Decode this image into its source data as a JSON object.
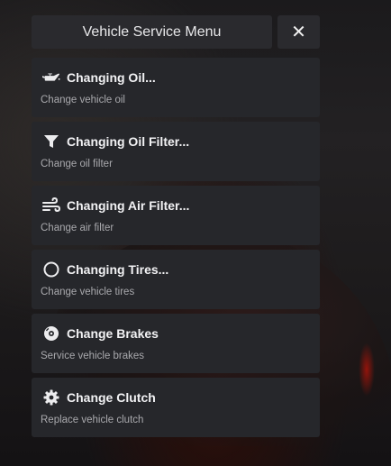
{
  "header": {
    "title": "Vehicle Service Menu",
    "close_label": "✕"
  },
  "menu": {
    "items": [
      {
        "icon": "oil-can-icon",
        "label": "Changing Oil...",
        "description": "Change vehicle oil"
      },
      {
        "icon": "filter-icon",
        "label": "Changing Oil Filter...",
        "description": "Change oil filter"
      },
      {
        "icon": "wind-icon",
        "label": "Changing Air Filter...",
        "description": "Change air filter"
      },
      {
        "icon": "circle-icon",
        "label": "Changing Tires...",
        "description": "Change vehicle tires"
      },
      {
        "icon": "brake-disc-icon",
        "label": "Change Brakes",
        "description": "Service vehicle brakes"
      },
      {
        "icon": "gear-icon",
        "label": "Change Clutch",
        "description": "Replace vehicle clutch"
      }
    ]
  },
  "colors": {
    "panel": "#2a2a2e",
    "item": "#26272b",
    "text": "#f2f2f4",
    "subtext": "#a9a9ad"
  }
}
